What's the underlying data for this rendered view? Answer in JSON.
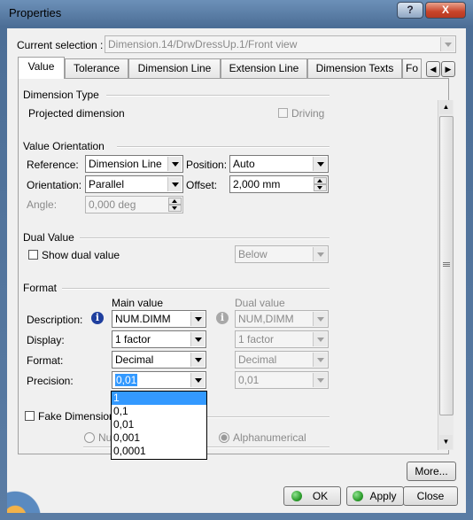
{
  "window": {
    "title": "Properties",
    "help_label": "?",
    "close_label": "X"
  },
  "current_selection": {
    "label": "Current selection :",
    "value": "Dimension.14/DrwDressUp.1/Front view"
  },
  "tabs": [
    {
      "label": "Value"
    },
    {
      "label": "Tolerance"
    },
    {
      "label": "Dimension Line"
    },
    {
      "label": "Extension Line"
    },
    {
      "label": "Dimension Texts"
    },
    {
      "label": "Fo"
    }
  ],
  "dimension_type": {
    "heading": "Dimension Type",
    "value": "Projected dimension",
    "driving_label": "Driving",
    "driving_checked": false
  },
  "value_orientation": {
    "heading": "Value Orientation",
    "reference_label": "Reference:",
    "reference_value": "Dimension Line",
    "position_label": "Position:",
    "position_value": "Auto",
    "orientation_label": "Orientation:",
    "orientation_value": "Parallel",
    "offset_label": "Offset:",
    "offset_value": "2,000 mm",
    "angle_label": "Angle:",
    "angle_value": "0,000 deg"
  },
  "dual_value": {
    "heading": "Dual Value",
    "show_label": "Show dual value",
    "show_checked": false,
    "placement_value": "Below"
  },
  "format": {
    "heading": "Format",
    "main_header": "Main value",
    "dual_header": "Dual value",
    "description_label": "Description:",
    "description_main": "NUM.DIMM",
    "description_dual": "NUM,DIMM",
    "display_label": "Display:",
    "display_main": "1 factor",
    "display_dual": "1 factor",
    "format_label": "Format:",
    "format_main": "Decimal",
    "format_dual": "Decimal",
    "precision_label": "Precision:",
    "precision_main": "0,01",
    "precision_dual": "0,01",
    "precision_options": [
      "1",
      "0,1",
      "0,01",
      "0,001",
      "0,0001"
    ],
    "precision_highlighted": "1",
    "info_icon_glyph": "i"
  },
  "fake_dimension": {
    "label": "Fake Dimension",
    "checked": false,
    "numerical_label_partial": "Nu",
    "alphanumerical_label": "Alphanumerical"
  },
  "buttons": {
    "more": "More...",
    "ok": "OK",
    "apply": "Apply",
    "close": "Close"
  },
  "colors": {
    "title_gradient_top": "#6c90b8",
    "info_icon": "#1f3f9e",
    "highlight": "#3399ff",
    "ok_icon": "#2e9e2e",
    "close_button": "#c8442a"
  }
}
